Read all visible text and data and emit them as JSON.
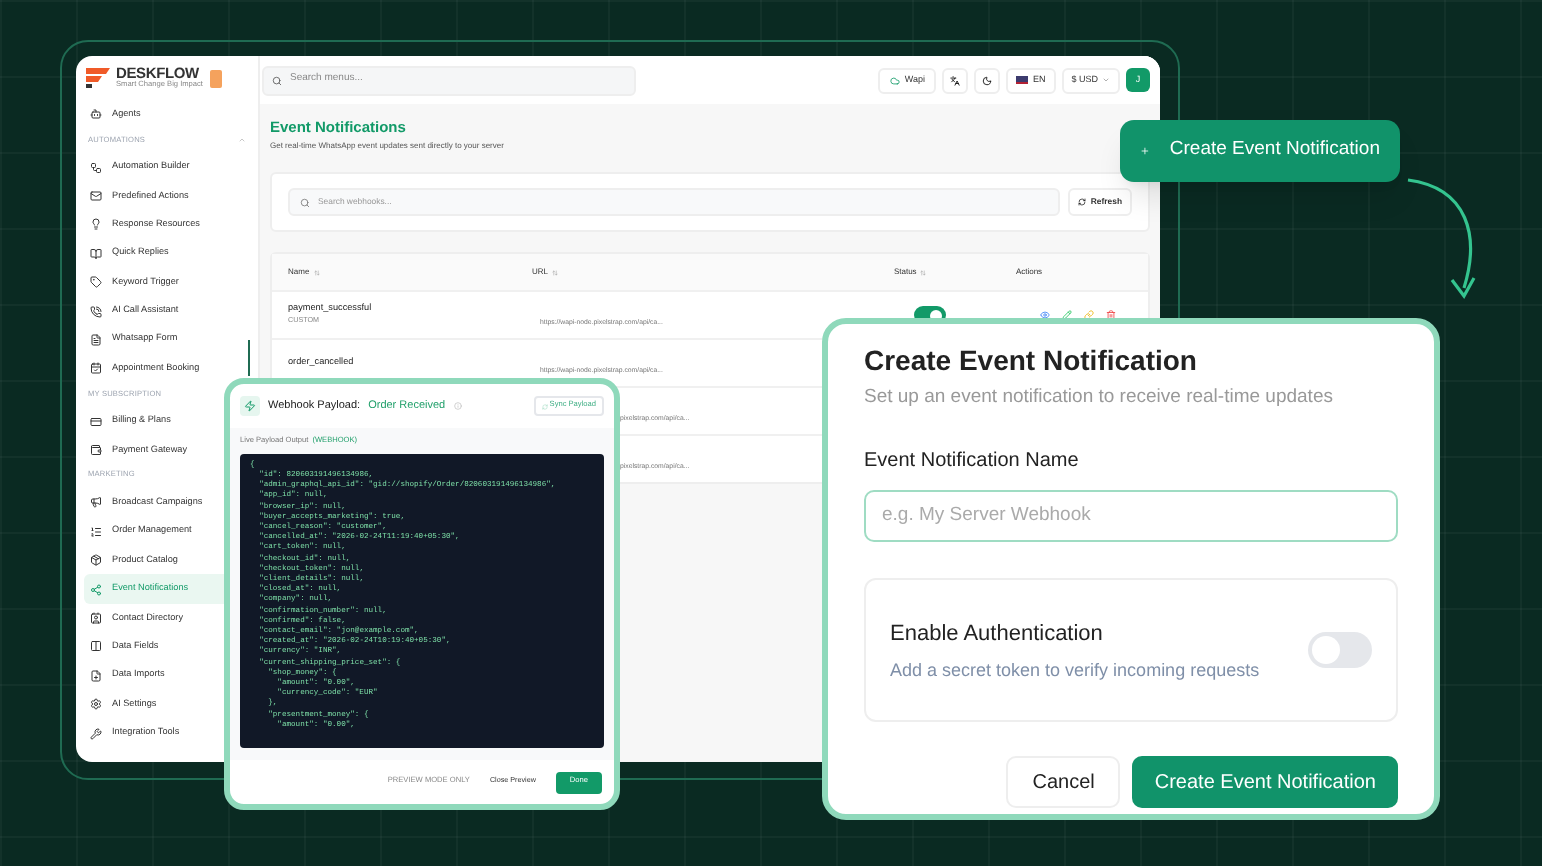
{
  "sidebar": {
    "logo": "DESKFLOW",
    "tagline": "Smart Change Big Impact",
    "items": [
      {
        "kind": "item",
        "label": "Agents",
        "selected": false
      },
      {
        "kind": "section",
        "label": "AUTOMATIONS"
      },
      {
        "kind": "item",
        "label": "Automation Builder",
        "selected": false
      },
      {
        "kind": "item",
        "label": "Predefined Actions",
        "selected": false
      },
      {
        "kind": "item",
        "label": "Response Resources",
        "selected": false
      },
      {
        "kind": "item",
        "label": "Quick Replies",
        "selected": false
      },
      {
        "kind": "item",
        "label": "Keyword Trigger",
        "selected": false
      },
      {
        "kind": "item",
        "label": "AI Call Assistant",
        "selected": false
      },
      {
        "kind": "item",
        "label": "Whatsapp Form",
        "selected": false
      },
      {
        "kind": "item",
        "label": "Appointment Booking",
        "selected": false
      },
      {
        "kind": "section",
        "label": "MY SUBSCRIPTION"
      },
      {
        "kind": "item",
        "label": "Billing & Plans",
        "selected": false
      },
      {
        "kind": "item",
        "label": "Payment Gateway",
        "selected": false
      },
      {
        "kind": "section",
        "label": "MARKETING"
      },
      {
        "kind": "item",
        "label": "Broadcast Campaigns",
        "selected": false
      },
      {
        "kind": "item",
        "label": "Order Management",
        "selected": false
      },
      {
        "kind": "item",
        "label": "Product Catalog",
        "selected": false
      },
      {
        "kind": "item",
        "label": "Event Notifications",
        "selected": true
      },
      {
        "kind": "item",
        "label": "Contact Directory",
        "selected": false
      },
      {
        "kind": "item",
        "label": "Data Fields",
        "selected": false
      },
      {
        "kind": "item",
        "label": "Data Imports",
        "selected": false
      },
      {
        "kind": "item",
        "label": "AI Settings",
        "selected": false
      },
      {
        "kind": "item",
        "label": "Integration Tools",
        "selected": false
      }
    ]
  },
  "topbar": {
    "search_placeholder": "Search menus...",
    "workspace": "Wapi",
    "language": "EN",
    "currency": "$ USD",
    "avatar": "J"
  },
  "page": {
    "title": "Event Notifications",
    "subtitle": "Get real-time WhatsApp event updates sent directly to your server",
    "search_placeholder": "Search webhooks...",
    "refresh": "Refresh",
    "create_button": "Create Event Notification"
  },
  "table": {
    "columns": [
      "Name",
      "URL",
      "Status",
      "Actions"
    ],
    "rows": [
      {
        "name": "payment_successful",
        "tag": "CUSTOM",
        "url": "https://wapi-node.pixelstrap.com/api/ca...",
        "on": true
      },
      {
        "name": "order_cancelled",
        "url": "https://wapi-node.pixelstrap.com/api/ca..."
      },
      {
        "url": "pixelstrap.com/api/ca..."
      },
      {
        "url": "pixelstrap.com/api/ca..."
      }
    ]
  },
  "payload": {
    "title": "Webhook Payload:",
    "event": "Order Received",
    "sync": "Sync Payload",
    "output_label": "Live Payload Output",
    "output_tag": "(WEBHOOK)",
    "code": [
      "{",
      "  \"id\": 820603191496134986,",
      "  \"admin_graphql_api_id\": \"gid://shopify/Order/820603191496134986\",",
      "  \"app_id\": null,",
      "  \"browser_ip\": null,",
      "  \"buyer_accepts_marketing\": true,",
      "  \"cancel_reason\": \"customer\",",
      "  \"cancelled_at\": \"2026-02-24T11:19:40+05:30\",",
      "  \"cart_token\": null,",
      "  \"checkout_id\": null,",
      "  \"checkout_token\": null,",
      "  \"client_details\": null,",
      "  \"closed_at\": null,",
      "  \"company\": null,",
      "  \"confirmation_number\": null,",
      "  \"confirmed\": false,",
      "  \"contact_email\": \"jon@example.com\",",
      "  \"created_at\": \"2026-02-24T10:19:40+05:30\",",
      "  \"currency\": \"INR\",",
      "  \"current_shipping_price_set\": {",
      "    \"shop_money\": {",
      "      \"amount\": \"0.00\",",
      "      \"currency_code\": \"EUR\"",
      "    },",
      "    \"presentment_money\": {",
      "      \"amount\": \"0.00\","
    ],
    "mode": "PREVIEW MODE ONLY",
    "close": "Close Preview",
    "done": "Done"
  },
  "dialog": {
    "title": "Create Event Notification",
    "subtitle": "Set up an event notification to receive real-time updates",
    "name_label": "Event Notification Name",
    "name_placeholder": "e.g. My Server Webhook",
    "auth_title": "Enable Authentication",
    "auth_text": "Add a secret token to verify incoming requests",
    "auth_on": false,
    "cancel": "Cancel",
    "submit": "Create Event Notification"
  }
}
